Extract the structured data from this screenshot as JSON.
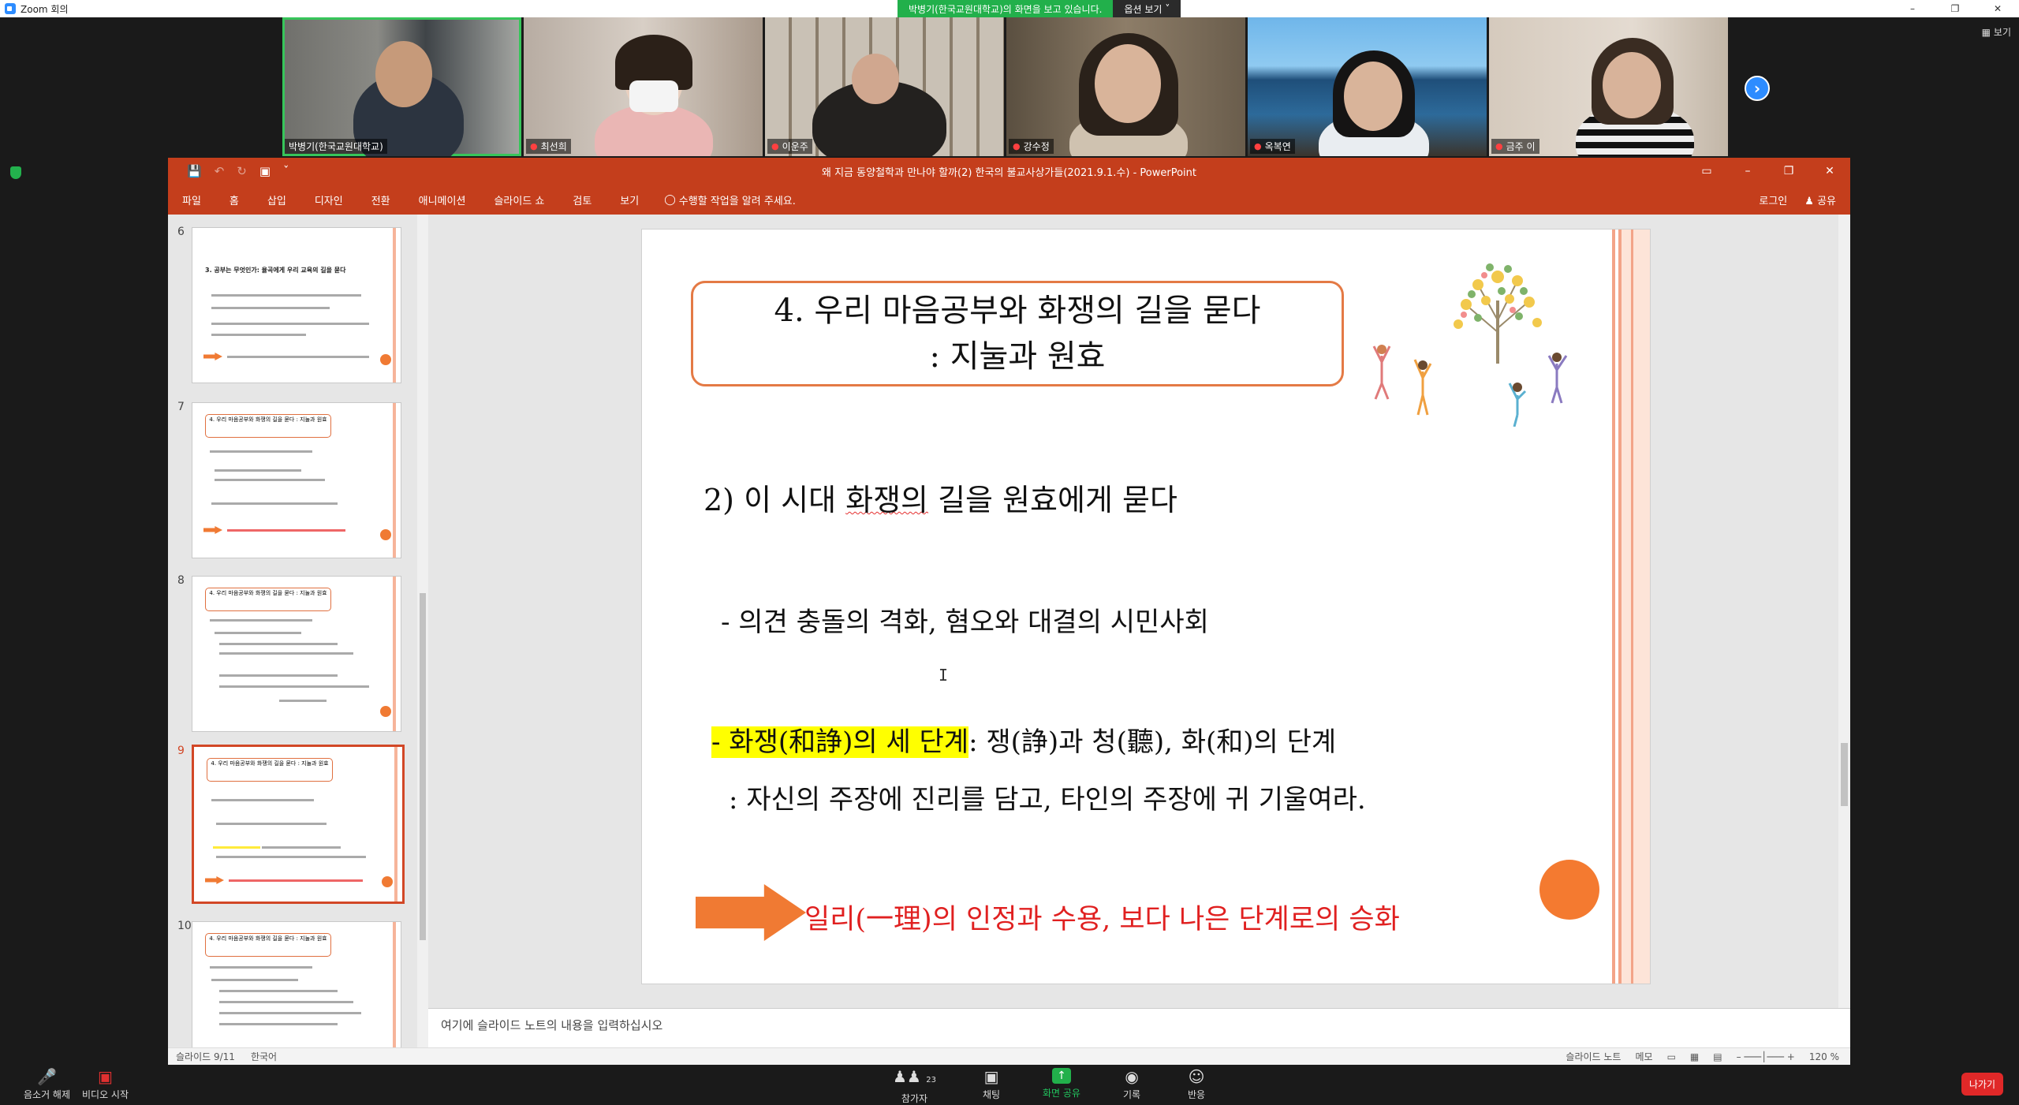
{
  "zoom": {
    "window_title": "Zoom 회의",
    "share_banner": "박병기(한국교원대학교)의 화면을 보고 있습니다.",
    "view_options": "옵션 보기",
    "view_button": "보기",
    "participants": [
      {
        "name": "박병기(한국교원대학교)",
        "muted": false
      },
      {
        "name": "최선희",
        "muted": true
      },
      {
        "name": "이운주",
        "muted": true
      },
      {
        "name": "강수정",
        "muted": true
      },
      {
        "name": "옥복연",
        "muted": true
      },
      {
        "name": "금주 이",
        "muted": true
      }
    ],
    "toolbar": {
      "mute": "음소거 해제",
      "video": "비디오 시작",
      "participants": "참가자",
      "participant_count": "23",
      "chat": "채팅",
      "share": "화면 공유",
      "record": "기록",
      "reactions": "반응",
      "leave": "나가기"
    },
    "colors": {
      "accent": "#2d8cff",
      "banner": "#22b04b",
      "leave": "#e02828"
    }
  },
  "ppt": {
    "doc_title": "왜 지금 동양철학과 만나야 할까(2) 한국의 불교사상가들(2021.9.1.수) - PowerPoint",
    "ribbon_tabs": [
      "파일",
      "홈",
      "삽입",
      "디자인",
      "전환",
      "애니메이션",
      "슬라이드 쇼",
      "검토",
      "보기"
    ],
    "tell_me": "수행할 작업을 알려 주세요.",
    "login": "로그인",
    "share": "공유",
    "thumbnails": [
      {
        "num": "6",
        "title": "3. 공부는 무엇인가: 율곡에게 우리 교육의 길을 묻다"
      },
      {
        "num": "7",
        "title": "4. 우리 마음공부와 화쟁의 길을 묻다 : 지눌과 원효"
      },
      {
        "num": "8",
        "title": "4. 우리 마음공부와 화쟁의 길을 묻다 : 지눌과 원효"
      },
      {
        "num": "9",
        "title": "4. 우리 마음공부와 화쟁의 길을 묻다 : 지눌과 원효"
      },
      {
        "num": "10",
        "title": "4. 우리 마음공부와 화쟁의 길을 묻다 : 지눌과 원효"
      }
    ],
    "slide": {
      "title_line1": "4. 우리 마음공부와 화쟁의 길을 묻다",
      "title_line2": ": 지눌과 원효",
      "subtitle_pre": "2) 이 시대 ",
      "subtitle_wavy": "화쟁의",
      "subtitle_post": " 길을 원효에게 묻다",
      "bullet1": "- 의견 충돌의 격화, 혐오와 대결의 시민사회",
      "bullet2_highlight": "-  화쟁(和諍)의 세 단계",
      "bullet2_rest": ": 쟁(諍)과 청(聽), 화(和)의 단계",
      "bullet3": ": 자신의 주장에 진리를 담고, 타인의 주장에 귀 기울여라.",
      "conclusion": "일리(一理)의 인정과 수용, 보다 나은 단계로의 승화"
    },
    "notes_placeholder": "여기에 슬라이드 노트의 내용을 입력하십시오",
    "status": {
      "slide": "슬라이드 9/11",
      "lang": "한국어",
      "notes": "슬라이드 노트",
      "memo": "메모",
      "zoom": "120 %"
    },
    "colors": {
      "accent": "#c43e1c",
      "title_border": "#e47a45",
      "conclusion": "#e02020",
      "highlight": "#ffff00"
    }
  }
}
